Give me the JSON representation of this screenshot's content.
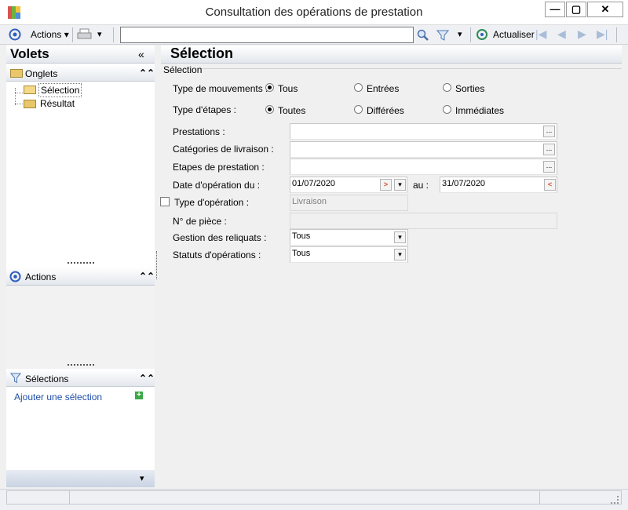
{
  "window": {
    "title": "Consultation des opérations de prestation",
    "min": "—",
    "max": "▢",
    "close": "✕"
  },
  "toolbar": {
    "actions_label": "Actions",
    "search_value": "",
    "refresh_label": "Actualiser"
  },
  "left": {
    "volets_title": "Volets",
    "collapse_glyph": "«",
    "onglets_title": "Onglets",
    "tree": [
      "Sélection",
      "Résultat"
    ],
    "actions_title": "Actions",
    "selections_title": "Sélections",
    "add_selection": "Ajouter une sélection",
    "expand_glyph": "⌃⌃",
    "bottom_arrow": "▾"
  },
  "main": {
    "title": "Sélection",
    "group_label": "Sélection",
    "mouvements": {
      "label": "Type de mouvements :",
      "options": [
        "Tous",
        "Entrées",
        "Sorties"
      ],
      "selected": 0
    },
    "etapes": {
      "label": "Type d'étapes :",
      "options": [
        "Toutes",
        "Différées",
        "Immédiates"
      ],
      "selected": 0
    },
    "prestations_label": "Prestations :",
    "categories_label": "Catégories de livraison :",
    "etapes_prestation_label": "Etapes de prestation :",
    "date_label": "Date d'opération du :",
    "date_from": "01/07/2020",
    "date_au": "au :",
    "date_to": "31/07/2020",
    "type_operation_label": "Type d'opération :",
    "type_operation_value": "Livraison",
    "piece_label": "N° de pièce :",
    "reliquats_label": "Gestion des reliquats :",
    "reliquats_value": "Tous",
    "statuts_label": "Statuts d'opérations :",
    "statuts_value": "Tous",
    "ellipsis": "..."
  },
  "colors": {
    "accent": "#2f5fbf",
    "header_grad": "#e3e7ed"
  }
}
